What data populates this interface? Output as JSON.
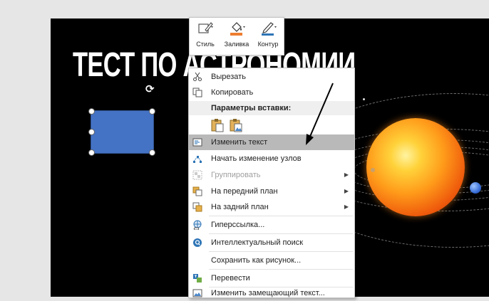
{
  "slide": {
    "title": "ТЕСТ ПО АСТРОНОМИИ"
  },
  "mini_toolbar": {
    "items": [
      {
        "label": "Стиль",
        "icon": "style-pen-icon"
      },
      {
        "label": "Заливка",
        "icon": "fill-bucket-icon"
      },
      {
        "label": "Контур",
        "icon": "outline-pen-icon"
      }
    ]
  },
  "context_menu": {
    "cut": "Вырезать",
    "copy": "Копировать",
    "paste_options_header": "Параметры вставки:",
    "edit_text": "Изменить текст",
    "edit_points": "Начать изменение узлов",
    "group": "Группировать",
    "bring_to_front": "На передний план",
    "send_to_back": "На задний план",
    "hyperlink": "Гиперссылка...",
    "smart_lookup": "Интеллектуальный поиск",
    "save_as_picture": "Сохранить как рисунок...",
    "translate": "Перевести",
    "edit_alt_text": "Изменить замещающий текст..."
  },
  "colors": {
    "shape_fill": "#4472c4",
    "highlight": "#b9b9b9",
    "slide_background": "#000000"
  }
}
